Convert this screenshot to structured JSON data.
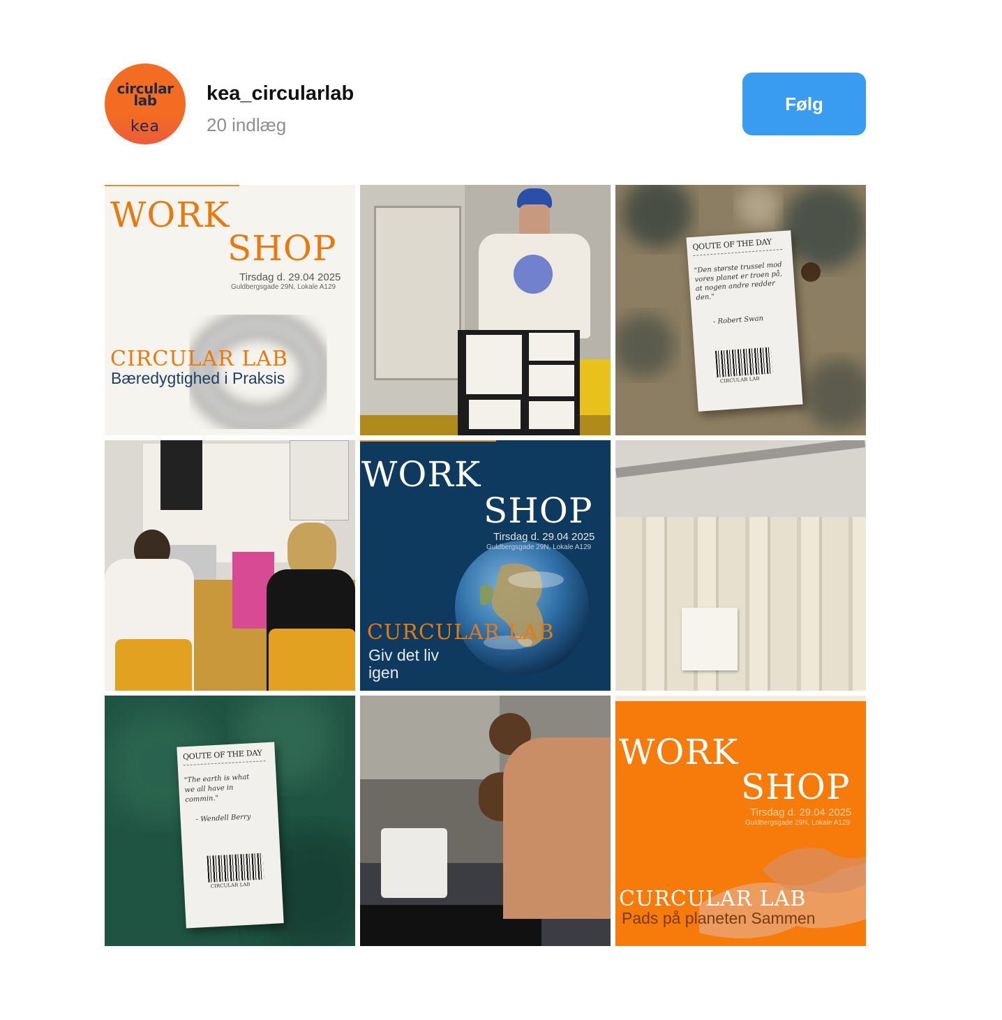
{
  "profile": {
    "avatar_lines": [
      "circular",
      "lab"
    ],
    "avatar_brand": "kea",
    "username": "kea_circularlab",
    "post_count": "20 indlæg",
    "follow_label": "Følg"
  },
  "posts": {
    "p1": {
      "line1": "WORK",
      "line2": "SHOP",
      "date": "Tirsdag d. 29.04 2025",
      "address": "Guldbergsgade 29N, Lokale A129",
      "brand": "CIRCULAR LAB",
      "tagline": "Bæredygtighed i Praksis"
    },
    "p3": {
      "heading": "QOUTE OF THE DAY",
      "quote": "\"Den største trussel mod vores planet er troen på, at nogen andre redder den.\"",
      "author": "- Robert Swan",
      "barcode_label": "CIRCULAR  LAB"
    },
    "p5": {
      "line1": "WORK",
      "line2": "SHOP",
      "date": "Tirsdag d. 29.04 2025",
      "address": "Guldbergsgade 29N, Lokale A129",
      "brand": "CURCULAR LAB",
      "tagline1": "Giv det liv",
      "tagline2": "igen"
    },
    "p7": {
      "heading": "QOUTE OF THE DAY",
      "quote": "\"The earth is what we all have in commin.\"",
      "author": "- Wendell Berry",
      "barcode_label": "CIRCULAR  LAB"
    },
    "p9": {
      "line1": "WORK",
      "line2": "SHOP",
      "date": "Tirsdag d. 29.04 2025",
      "address": "Guldbergsgade 29N, Lokale A129",
      "brand": "CURCULAR LAB",
      "tagline": "Pads på planeten Sammen"
    }
  },
  "colors": {
    "follow_button": "#3a9cf0",
    "brand_orange": "#f26c21",
    "navy": "#0f3a5f"
  }
}
